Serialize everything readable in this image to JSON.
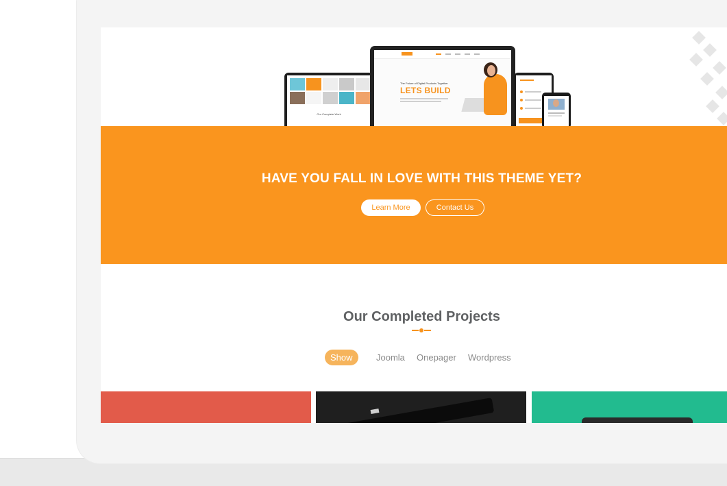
{
  "hero": {
    "preview_heading": "LETS BUILD",
    "preview_subheading": "The Future of Digital Products Together",
    "tablet_caption": "Our Complete Work"
  },
  "cta": {
    "title": "HAVE YOU FALL IN LOVE WITH THIS THEME YET?",
    "learn_more_label": "Learn More",
    "contact_label": "Contact Us"
  },
  "projects": {
    "title": "Our Completed Projects",
    "filters": [
      {
        "label": "Show All",
        "active": true
      },
      {
        "label": "Joomla",
        "active": false
      },
      {
        "label": "Onepager",
        "active": false
      },
      {
        "label": "Wordpress",
        "active": false
      }
    ]
  },
  "colors": {
    "accent": "#fa951e",
    "filter_active": "#f6b45c",
    "tile_red": "#e25b4a",
    "tile_dark": "#1f1f1f",
    "tile_green": "#22bb8f"
  }
}
